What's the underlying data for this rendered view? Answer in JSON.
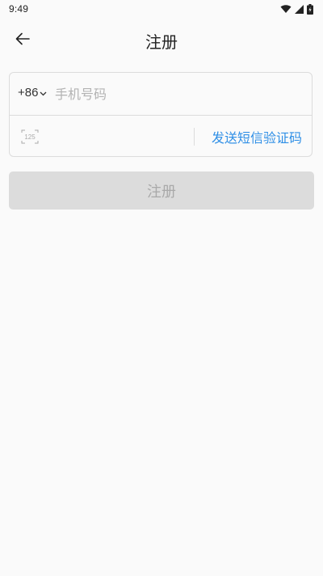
{
  "status_bar": {
    "time": "9:49",
    "icons": [
      "wifi-icon",
      "signal-icon",
      "battery-icon"
    ]
  },
  "app_bar": {
    "back_icon": "back-arrow-icon",
    "title": "注册"
  },
  "form": {
    "country_code": "+86",
    "country_code_icon": "chevron-down-icon",
    "phone_placeholder": "手机号码",
    "phone_value": "",
    "sms_code_icon": "sms-code-icon",
    "sms_code_icon_text": "125",
    "code_value": "",
    "send_code_label": "发送短信验证码"
  },
  "register_button": {
    "label": "注册"
  },
  "colors": {
    "background": "#fafafa",
    "border": "#dcdcdc",
    "link": "#2f8fe6",
    "button_disabled_bg": "#dcdcdc",
    "button_disabled_text": "#a9a9a9",
    "placeholder": "#b3b3b3"
  }
}
